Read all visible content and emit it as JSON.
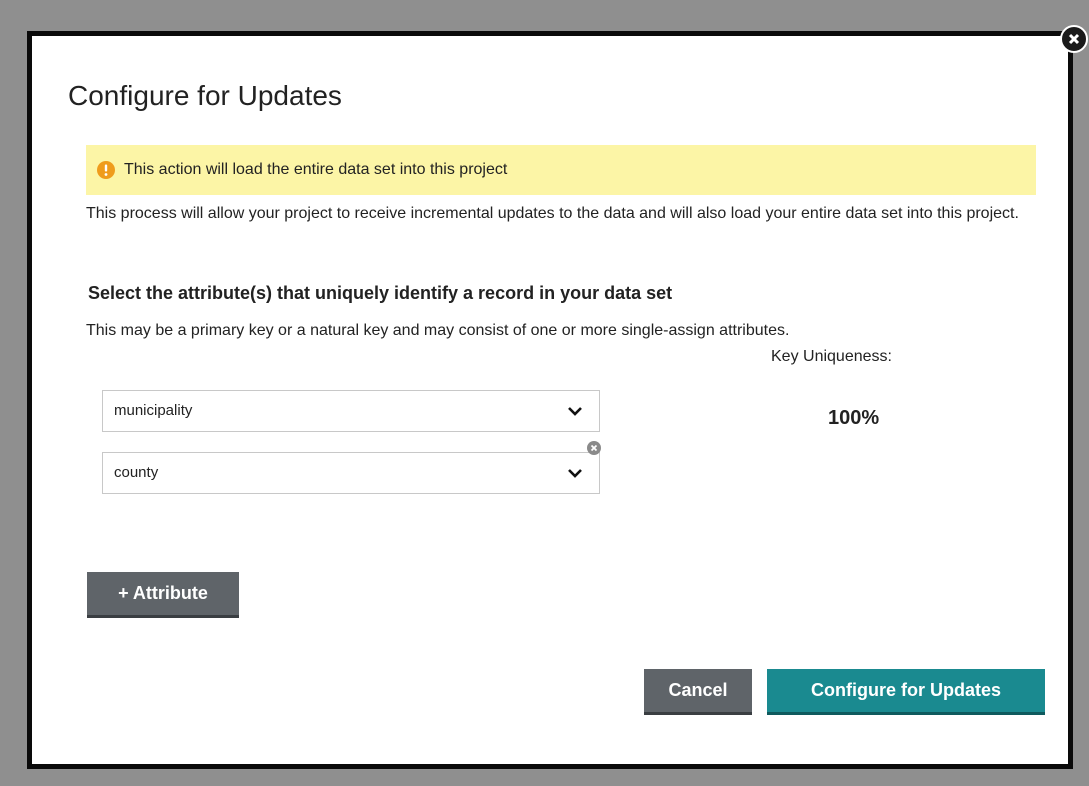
{
  "dialog": {
    "title": "Configure for Updates",
    "warning_text": "This action will load the entire data set into this project",
    "description": "This process will allow your project to receive incremental updates to the data and will also load your entire data set into this project."
  },
  "attributes": {
    "section_title": "Select the attribute(s) that uniquely identify a record in your data set",
    "section_desc": "This may be a primary key or a natural key and may consist of one or more single-assign attributes.",
    "selects": [
      {
        "value": "municipality"
      },
      {
        "value": "county"
      }
    ],
    "key_uniqueness_label": "Key Uniqueness:",
    "key_uniqueness_value": "100%"
  },
  "buttons": {
    "add_attribute": "+ Attribute",
    "cancel": "Cancel",
    "configure": "Configure for Updates"
  },
  "colors": {
    "warning_bg": "#fcf5a6",
    "warning_icon": "#ef9c1c",
    "primary": "#1a8a90",
    "secondary": "#5f6469"
  },
  "icons": {
    "close": "close-icon",
    "warning": "warning-icon",
    "chevron": "chevron-down-icon",
    "remove": "remove-icon"
  }
}
